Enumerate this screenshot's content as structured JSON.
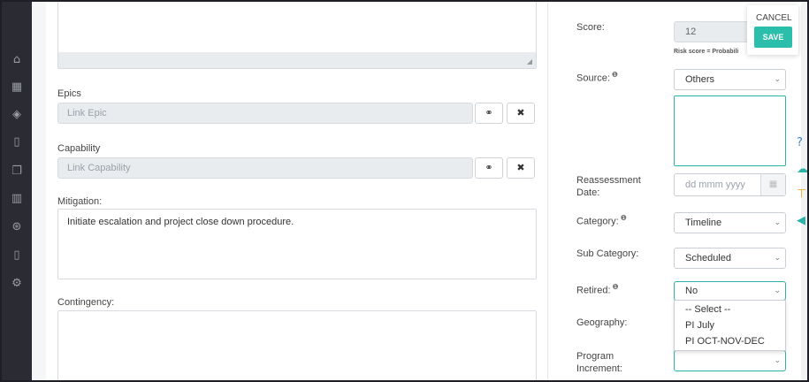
{
  "sidebar": {
    "icons": [
      "home-icon",
      "calendar-icon",
      "layers-icon",
      "book-icon",
      "copy-icon",
      "bar-chart-icon",
      "basketball-icon",
      "mobile-icon",
      "settings-icon"
    ],
    "glyphs": [
      "⌂",
      "▦",
      "◈",
      "▯",
      "❐",
      "▥",
      "⊛",
      "▯",
      "⚙"
    ]
  },
  "left": {
    "epics": {
      "label": "Epics",
      "placeholder": "Link Epic",
      "link_glyph": "⚭",
      "clear_glyph": "✖"
    },
    "capability": {
      "label": "Capability",
      "placeholder": "Link Capability",
      "link_glyph": "⚭",
      "clear_glyph": "✖"
    },
    "mitigation": {
      "label": "Mitigation:",
      "value": "Initiate escalation and project close down procedure."
    },
    "contingency": {
      "label": "Contingency:"
    }
  },
  "right": {
    "score": {
      "label": "Score:",
      "value": "12",
      "note": "Risk score = Probabili"
    },
    "source": {
      "label": "Source:",
      "value": "Others"
    },
    "reassessment": {
      "label_line1": "Reassessment",
      "label_line2": "Date:",
      "placeholder": "dd mmm yyyy"
    },
    "category": {
      "label": "Category:",
      "value": "Timeline"
    },
    "sub_category": {
      "label": "Sub Category:",
      "value": "Scheduled"
    },
    "retired": {
      "label": "Retired:",
      "value": "No"
    },
    "geography": {
      "label": "Geography:"
    },
    "program_increment": {
      "label_line1": "Program",
      "label_line2": "Increment:",
      "value": ""
    },
    "dropdown_options": [
      "-- Select --",
      "PI July",
      "PI OCT-NOV-DEC"
    ],
    "info_glyph": "❶",
    "chevron_glyph": "⌄"
  },
  "popover": {
    "cancel_label": "CANCEL",
    "save_label": "SAVE"
  },
  "side_tools": {
    "icons": [
      "help-icon",
      "cloud-icon",
      "paint-icon",
      "megaphone-icon"
    ],
    "glyphs": [
      "?",
      "☁",
      "⊤",
      "◀"
    ],
    "colors": [
      "#3b82c4",
      "#2ab3a8",
      "#e8a317",
      "#2ab3a8"
    ]
  }
}
